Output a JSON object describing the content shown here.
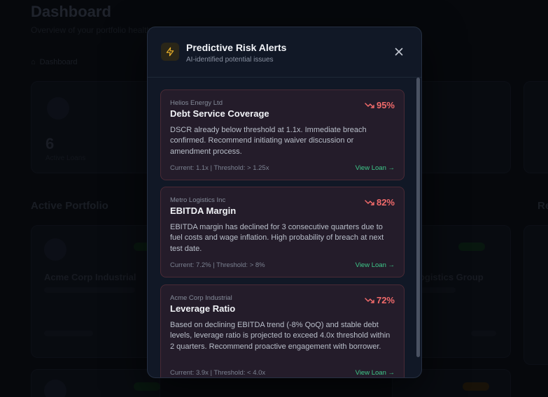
{
  "background": {
    "title": "Dashboard",
    "subtitle": "Overview of your portfolio health",
    "breadcrumb": "Dashboard",
    "stat_value": "6",
    "stat_label": "Active Loans",
    "section_title": "Active Portfolio",
    "portfolio_names": [
      "Acme Corp Industrial",
      "Logistics Group"
    ],
    "right_section": "Re"
  },
  "modal": {
    "title": "Predictive Risk Alerts",
    "subtitle": "AI-identified potential issues",
    "icon": "lightning-icon",
    "close_icon": "close-icon",
    "accent_color": "#f0b429",
    "alert_color": "#f06a6a",
    "link_color": "#3ec98a",
    "alerts": [
      {
        "company": "Helios Energy Ltd",
        "metric": "Debt Service Coverage",
        "probability": "95%",
        "description": "DSCR already below threshold at 1.1x. Immediate breach confirmed. Recommend initiating waiver discussion or amendment process.",
        "footer": "Current: 1.1x | Threshold: > 1.25x",
        "link": "View Loan →"
      },
      {
        "company": "Metro Logistics Inc",
        "metric": "EBITDA Margin",
        "probability": "82%",
        "description": "EBITDA margin has declined for 3 consecutive quarters due to fuel costs and wage inflation. High probability of breach at next test date.",
        "footer": "Current: 7.2% | Threshold: > 8%",
        "link": "View Loan →"
      },
      {
        "company": "Acme Corp Industrial",
        "metric": "Leverage Ratio",
        "probability": "72%",
        "description": "Based on declining EBITDA trend (-8% QoQ) and stable debt levels, leverage ratio is projected to exceed 4.0x threshold within 2 quarters. Recommend proactive engagement with borrower.",
        "footer": "Current: 3.9x | Threshold: < 4.0x",
        "link": "View Loan →"
      }
    ]
  }
}
